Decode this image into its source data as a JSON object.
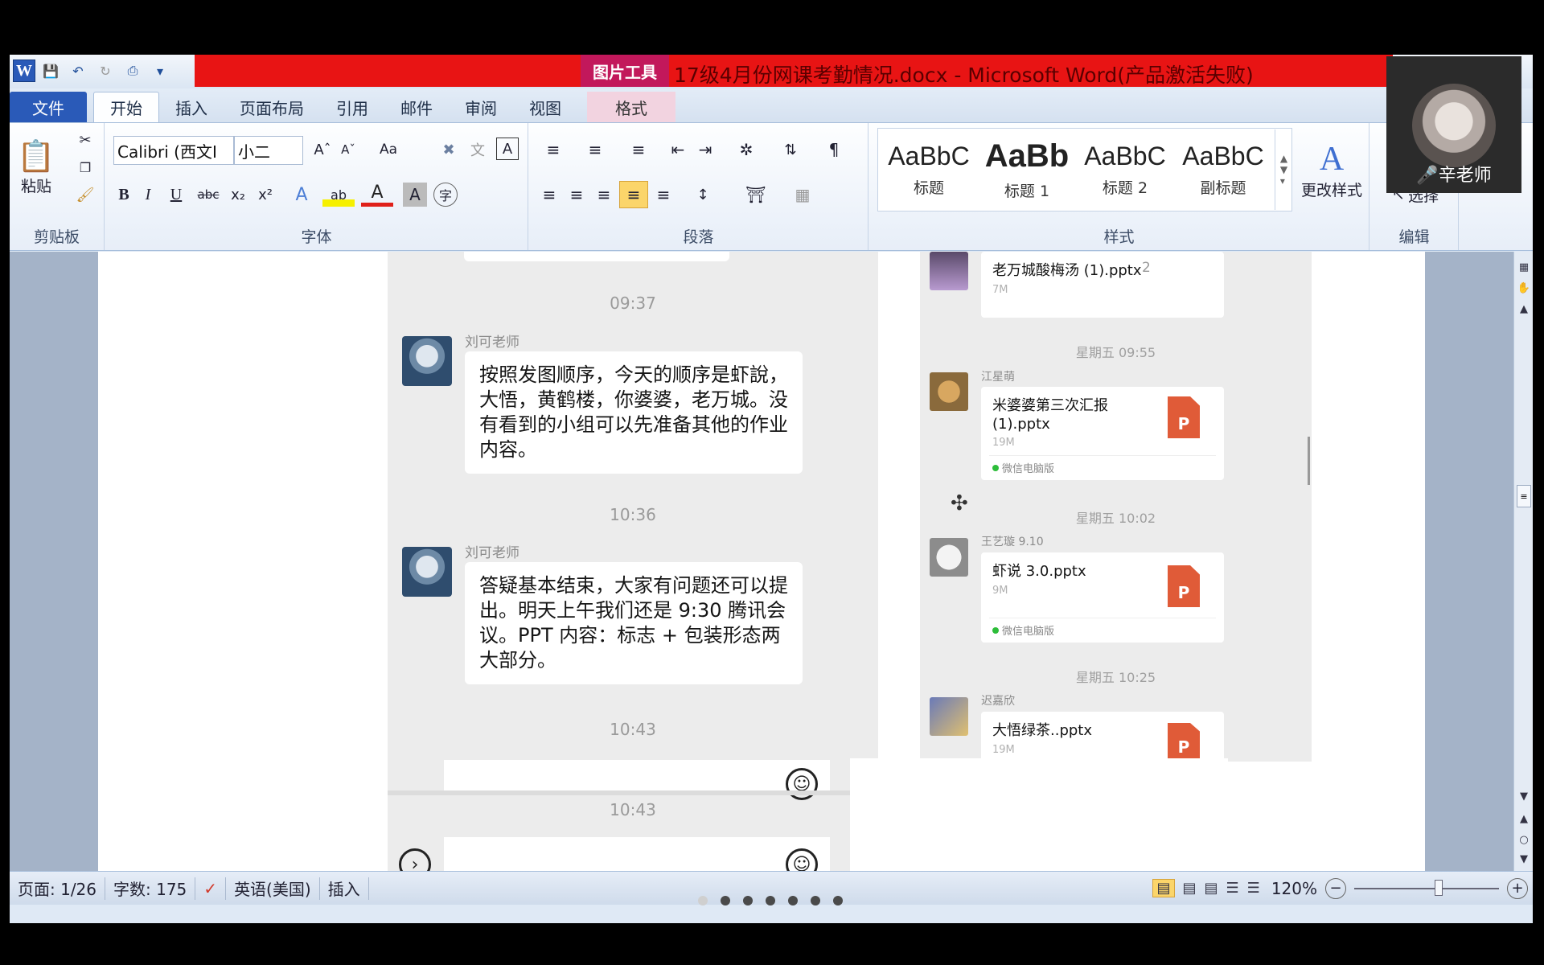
{
  "window": {
    "title": "17级4月份网课考勤情况.docx - Microsoft Word(产品激活失败)",
    "picture_tools_label": "图片工具"
  },
  "tabs": [
    "文件",
    "开始",
    "插入",
    "页面布局",
    "引用",
    "邮件",
    "审阅",
    "视图",
    "格式"
  ],
  "ribbon": {
    "clipboard": {
      "paste_label": "粘贴",
      "group_label": "剪贴板"
    },
    "font": {
      "font_name": "Calibri (西文I",
      "font_size": "小二",
      "group_label": "字体",
      "case_label": "Aa"
    },
    "paragraph": {
      "group_label": "段落"
    },
    "styles": {
      "items": [
        {
          "sample": "AaBbC",
          "name": "标题"
        },
        {
          "sample": "AaBb",
          "name": "标题 1"
        },
        {
          "sample": "AaBbC",
          "name": "标题 2"
        },
        {
          "sample": "AaBbC",
          "name": "副标题"
        }
      ],
      "change_styles_label": "更改样式",
      "group_label": "样式"
    },
    "editing": {
      "select_label": "选择",
      "group_label": "编辑"
    }
  },
  "chat_left": {
    "timestamps": [
      "09:37",
      "10:36",
      "10:43",
      "10:43"
    ],
    "messages": [
      {
        "sender": "刘可老师",
        "text": "按照发图顺序，今天的顺序是虾說，大悟，黄鹤楼，你婆婆，老万城。没有看到的小组可以先准备其他的作业内容。"
      },
      {
        "sender": "刘可老师",
        "text": "答疑基本结束，大家有问题还可以提出。明天上午我们还是 9:30 腾讯会议。PPT 内容：标志 + 包装形态两大部分。"
      }
    ]
  },
  "chat_right": {
    "partial_file": {
      "name": "老万城酸梅汤 (1).pptx",
      "size": "7M",
      "extra": "2"
    },
    "groups": [
      {
        "time": "星期五 09:55",
        "sender": "江星萌",
        "file": "米婆婆第三次汇报 (1).pptx",
        "size": "19M",
        "source": "微信电脑版"
      },
      {
        "time": "星期五 10:02",
        "sender": "王艺璇 9.10",
        "file": "虾说 3.0.pptx",
        "size": "9M",
        "source": "微信电脑版"
      },
      {
        "time": "星期五 10:25",
        "sender": "迟嘉欣",
        "file": "大悟绿茶..pptx",
        "size": "19M",
        "source": ""
      }
    ],
    "ppt_letter": "P"
  },
  "status": {
    "page": "页面: 1/26",
    "words": "字数: 175",
    "language": "英语(美国)",
    "mode": "插入",
    "zoom": "120%"
  },
  "webcam": {
    "name": "辛老师"
  },
  "slide_dots": {
    "count": 7,
    "active": 0
  }
}
